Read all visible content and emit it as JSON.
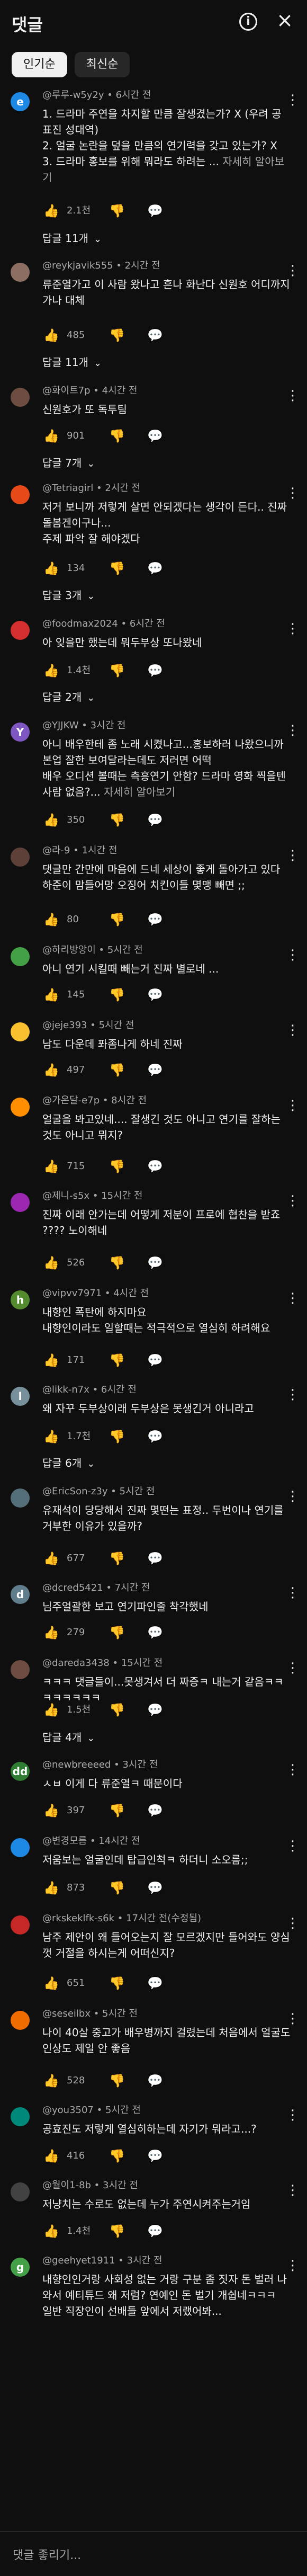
{
  "header": {
    "title": "댓글",
    "info_icon": "info-icon",
    "close_icon": "close-icon"
  },
  "tabs": [
    {
      "label": "인기순",
      "active": true
    },
    {
      "label": "최신순",
      "active": false
    }
  ],
  "reply_chevron_icon": "chevron-down-icon",
  "action_icons": {
    "like": "thumb-up-icon",
    "dislike": "thumb-down-icon",
    "reply": "reply-icon",
    "menu": "more-vert-icon"
  },
  "comments": [
    {
      "author_meta": "@루루-w5y2y • 6시간 전",
      "avatar_letter": "e",
      "avatar_color": "#1e88e5",
      "text": "1. 드라마 주연을 차지할 만큼 잘생겼는가? X (우려 공표진 성대역)\n2. 얼굴 논란을 덮을 만큼의 연기력을 갖고 있는가? X\n3. 드라마 홍보를 위해 뭐라도 하려는 ...",
      "more": "자세히 알아보기",
      "likes": "2.1천",
      "replies": "답글 11개"
    },
    {
      "author_meta": "@reykjavik555 • 2시간 전",
      "avatar_letter": "",
      "avatar_color": "#8d6e63",
      "text": "류준열가고 이 사람 왔나고 흔나 화난다 신원호 어디까지 가나 대체",
      "more": "",
      "likes": "485",
      "replies": "답글 11개"
    },
    {
      "author_meta": "@화이트7p • 4시간 전",
      "avatar_letter": "",
      "avatar_color": "#6d4c41",
      "text": "신원호가 또 독투팀",
      "more": "",
      "likes": "901",
      "replies": "답글 7개"
    },
    {
      "author_meta": "@Tetriagirl • 2시간 전",
      "avatar_letter": "",
      "avatar_color": "#e64a19",
      "text": "저거 보니까 저렇게 살면 안되겠다는 생각이 든다.. 진짜 돌봄겐이구나...\n주제 파악 잘 해야겠다",
      "more": "",
      "likes": "134",
      "replies": "답글 3개"
    },
    {
      "author_meta": "@foodmax2024 • 6시간 전",
      "avatar_letter": "",
      "avatar_color": "#d32f2f",
      "text": "아 잊을만 했는데 뭐두부상 또나왔네",
      "more": "",
      "likes": "1.4천",
      "replies": "답글 2개"
    },
    {
      "author_meta": "@YJJKW • 3시간 전",
      "avatar_letter": "Y",
      "avatar_color": "#7e57c2",
      "text": "아니 배우한테 좀 노래 시켰나고...홍보하러 나왔으니까 본업 잘한 보여달라는데도 저러면 어떡\n배우 오디션 볼때는 측흥연기 안함? 드라마 영화 찍을텐 사람 없음?...",
      "more": "자세히 알아보기",
      "likes": "350",
      "replies": "답글 7개"
    },
    {
      "author_meta": "@라-9 • 1시간 전",
      "avatar_letter": "",
      "avatar_color": "#5d4037",
      "text": "댓글만 간만에 마음에 드네 세상이 좋게 돌아가고 있다\n하준이 맘들어망 오징어 치킨이들 몇맹 빼면 ;;",
      "more": "",
      "likes": "80",
      "replies": ""
    },
    {
      "author_meta": "@하리방앙이 • 5시간 전",
      "avatar_letter": "",
      "avatar_color": "#43a047",
      "text": "아니 연기 시킬때 빼는거 진짜 별로네 ...",
      "more": "",
      "likes": "145",
      "replies": ""
    },
    {
      "author_meta": "@jeje393 • 5시간 전",
      "avatar_letter": "",
      "avatar_color": "#fbc02d",
      "text": "남도 다운데 퐈좀나게 하네 진짜",
      "more": "",
      "likes": "497",
      "replies": ""
    },
    {
      "author_meta": "@가온달-e7p • 8시간 전",
      "avatar_letter": "",
      "avatar_color": "#ff8f00",
      "text": "얼굴을 봐고있네.... 잘생긴 것도 아니고 연기를 잘하는 것도 아니고 뭐지?",
      "more": "",
      "likes": "715",
      "replies": ""
    },
    {
      "author_meta": "@제니-s5x • 15시간 전",
      "avatar_letter": "",
      "avatar_color": "#9c27b0",
      "text": "진짜 이래 안가는데 어떻게 저분이 프로에 협찬을 받죠 ???? 노이해네",
      "more": "",
      "likes": "526",
      "replies": ""
    },
    {
      "author_meta": "@vipvv7971 • 4시간 전",
      "avatar_letter": "h",
      "avatar_color": "#558b2f",
      "text": "내향인 폭탄에 하지마요\n내향인이라도 일할때는 적극적으로 열심히 하려해요",
      "more": "",
      "likes": "171",
      "replies": ""
    },
    {
      "author_meta": "@likk-n7x • 6시간 전",
      "avatar_letter": "l",
      "avatar_color": "#78909c",
      "text": "왜 자꾸 두부상이래 두부상은 못생긴거 아니라고",
      "more": "",
      "likes": "1.7천",
      "replies": "답글 6개"
    },
    {
      "author_meta": "@EricSon-z3y • 5시간 전",
      "avatar_letter": "",
      "avatar_color": "#546e7a",
      "text": "유재석이 당당해서 진짜 몇떤는 표정.. 두번이나 연기를 거부한 이유가 있을까?",
      "more": "",
      "likes": "677",
      "replies": ""
    },
    {
      "author_meta": "@dcred5421 • 7시간 전",
      "avatar_letter": "d",
      "avatar_color": "#607d8b",
      "text": "님주얼괄한 보고 연기파인줄 착각했네",
      "more": "",
      "likes": "279",
      "replies": ""
    },
    {
      "author_meta": "@dareda3438 • 15시간 전",
      "avatar_letter": "",
      "avatar_color": "#6d4c41",
      "text": "ㅋㅋㅋ 댓글들이...못생겨서 더 짜증ㅋ 내는거 같음ㅋㅋㅋㅋㅋㅋㅋㅋ",
      "more": "",
      "likes": "1.5천",
      "replies": "답글 4개"
    },
    {
      "author_meta": "@newbreeeed • 3시간 전",
      "avatar_letter": "dd",
      "avatar_color": "#2e7d32",
      "text": "ㅅㅂ 이게 다 류준열ㅋ 때문이다",
      "more": "",
      "likes": "397",
      "replies": ""
    },
    {
      "author_meta": "@변경모름 • 14시간 전",
      "avatar_letter": "",
      "avatar_color": "#1e88e5",
      "text": "저움보는 얼굴인데 탑급인척ㅋ 하더니 소오름;;",
      "more": "",
      "likes": "873",
      "replies": ""
    },
    {
      "author_meta": "@rkskeklfk-s6k • 17시간 전(수정됨)",
      "avatar_letter": "",
      "avatar_color": "#c62828",
      "text": "남주 제안이 왜 들어오는지 잘 모르겠지만 들어와도 양심껏 거절을 하시는게 어떠신지?",
      "more": "",
      "likes": "651",
      "replies": ""
    },
    {
      "author_meta": "@seseilbx • 5시간 전",
      "avatar_letter": "",
      "avatar_color": "#ef6c00",
      "text": "나이 40살 중고가 배우병까지 걸렸는데 처음에서 얼굴도 인상도 제일 안 좋음",
      "more": "",
      "likes": "528",
      "replies": ""
    },
    {
      "author_meta": "@you3507 • 5시간 전",
      "avatar_letter": "",
      "avatar_color": "#00897b",
      "text": "공효진도 저렇게 열심히하는데 자기가 뭐라고...?",
      "more": "",
      "likes": "416",
      "replies": ""
    },
    {
      "author_meta": "@월이1-8b • 3시간 전",
      "avatar_letter": "",
      "avatar_color": "#424242",
      "text": "저냥치는 수로도 없는데 누가 주연시켜주는거임",
      "more": "",
      "likes": "1.4천",
      "replies": ""
    },
    {
      "author_meta": "@geehyet1911 • 3시간 전",
      "avatar_letter": "g",
      "avatar_color": "#43a047",
      "text": "내향인인거랑 사회성 없는 거랑 구분 좀 짓자 돈 벌러 나와서 예티튜드 왜 저럼? 연예인 돈 벌기 개쉽네ㅋㅋㅋ\n일반 직장인이 선배들 앞에서 저랬어봐...",
      "more": "",
      "likes": "",
      "replies": ""
    }
  ],
  "composer": {
    "placeholder": "댓글 좋리기..."
  }
}
